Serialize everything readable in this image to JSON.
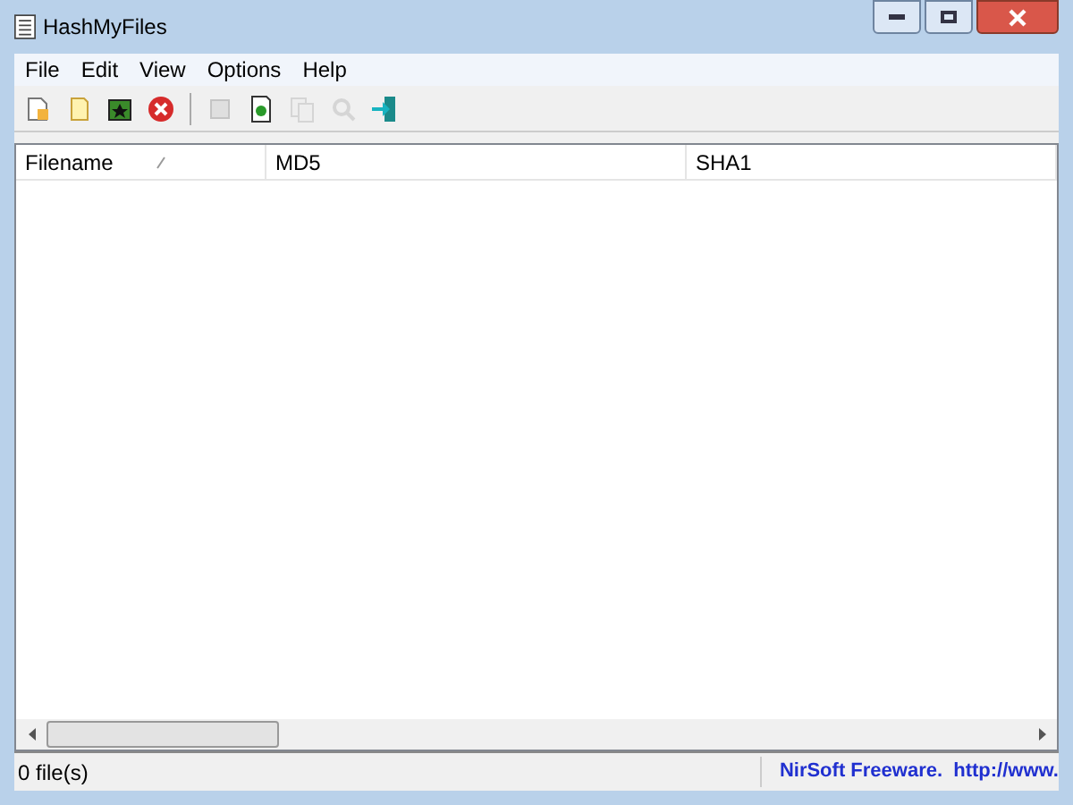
{
  "window": {
    "title": "HashMyFiles"
  },
  "menu": [
    "File",
    "Edit",
    "View",
    "Options",
    "Help"
  ],
  "toolbar": [
    {
      "kind": "button",
      "disabled": false
    },
    {
      "kind": "button",
      "disabled": false
    },
    {
      "kind": "button",
      "disabled": false
    },
    {
      "kind": "button",
      "disabled": false
    },
    {
      "kind": "separator"
    },
    {
      "kind": "button",
      "disabled": true
    },
    {
      "kind": "button",
      "disabled": false
    },
    {
      "kind": "button",
      "disabled": true
    },
    {
      "kind": "button",
      "disabled": true
    },
    {
      "kind": "button",
      "disabled": false
    }
  ],
  "table": {
    "columns": [
      {
        "label": "Filename",
        "sorted": true
      },
      {
        "label": "MD5",
        "sorted": false
      },
      {
        "label": "SHA1",
        "sorted": false
      }
    ]
  },
  "status_bar": {
    "count": "0 file(s)",
    "link": "NirSoft Freeware.  http://www."
  }
}
